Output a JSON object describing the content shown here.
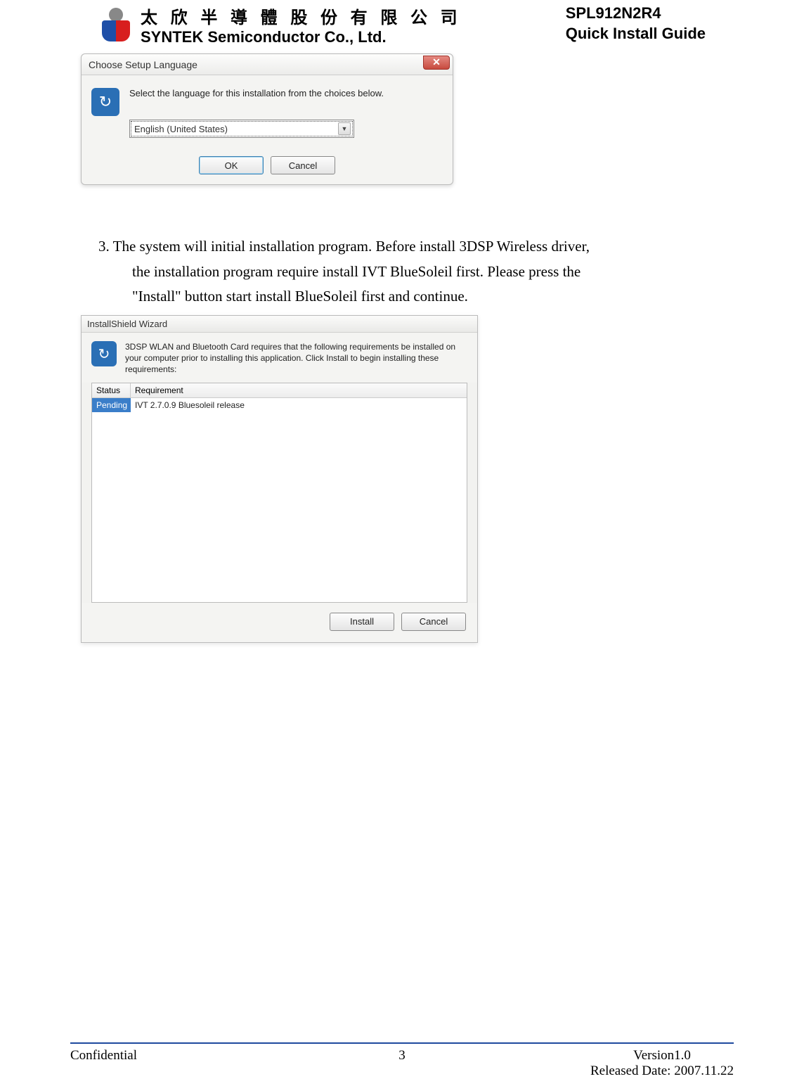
{
  "header": {
    "chinese_name": "太 欣 半 導 體 股 份 有 限 公 司",
    "english_name": "SYNTEK Semiconductor Co., Ltd.",
    "product": "SPL912N2R4",
    "doc_type": "Quick Install Guide"
  },
  "dialog1": {
    "title": "Choose Setup Language",
    "instruction": "Select the language for this installation from the choices below.",
    "selected_language": "English (United States)",
    "ok_label": "OK",
    "cancel_label": "Cancel"
  },
  "step3": {
    "number": "3.",
    "line1": "The system will initial installation program. Before install 3DSP Wireless driver,",
    "line2": "the installation program require install IVT BlueSoleil first. Please press the",
    "line3": "\"Install\" button start install BlueSoleil first and continue."
  },
  "dialog2": {
    "title": "InstallShield Wizard",
    "instruction": "3DSP WLAN and Bluetooth Card requires that the following requirements be installed on your computer prior to installing this application. Click Install to begin installing these requirements:",
    "columns": {
      "status": "Status",
      "requirement": "Requirement"
    },
    "rows": [
      {
        "status": "Pending",
        "requirement": "IVT 2.7.0.9 Bluesoleil release"
      }
    ],
    "install_label": "Install",
    "cancel_label": "Cancel"
  },
  "footer": {
    "confidential": "Confidential",
    "page_number": "3",
    "version": "Version1.0",
    "released": "Released Date: 2007.11.22"
  }
}
